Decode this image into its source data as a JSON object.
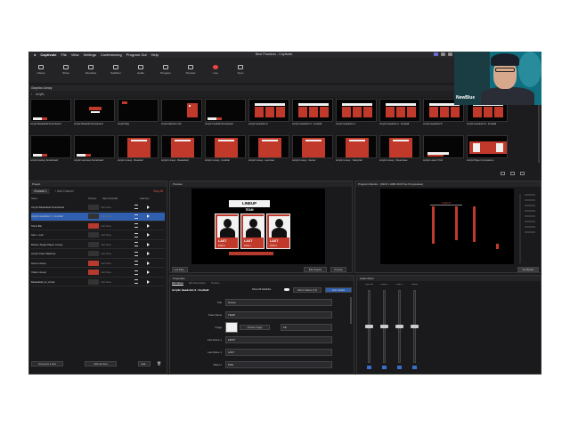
{
  "menubar": {
    "app": "Captivate",
    "items": [
      "File",
      "View",
      "Settings",
      "Conferencing",
      "Program Out",
      "Help"
    ],
    "window_title": "Best Practices - Captivate"
  },
  "toolbar": {
    "buttons": [
      "Library",
      "Show",
      "Favorites",
      "Switcher",
      "Audio",
      "Program",
      "Preview",
      "Live",
      "Sync"
    ]
  },
  "library": {
    "header": "Graphics Library",
    "path": "Acrylic",
    "row1": [
      "Acrylic Basketball Scoreboard",
      "Acrylic Baseball Scoreboard",
      "Acrylic Bug",
      "Acrylic Election Info",
      "Acrylic Football Scoreboard",
      "Acrylic Headshot 3",
      "Acrylic Headshot 3 - Football",
      "Acrylic Headshot 4",
      "Acrylic Headshot 4 - Football",
      "Acrylic Headshot 5",
      "Acrylic Headshot 5 - Football"
    ],
    "row2": [
      "Acrylic Hockey Scoreboard",
      "Acrylic Lacrosse Scoreboard",
      "Acrylic Lineup - Baseball",
      "Acrylic Lineup - Basketball",
      "Acrylic Lineup - Football",
      "Acrylic Lineup - Lacrosse",
      "Acrylic Lineup - Soccer",
      "Acrylic Lineup - Volleyball",
      "Acrylic Lineup - WLacrosse",
      "Acrylic Lower Third",
      "Acrylic Player Comparison"
    ]
  },
  "project": {
    "title": "Project",
    "channel": "Channel 1",
    "add_channel": "+ Add Channel",
    "stop_all": "Stop All",
    "columns": [
      "Name",
      "Preview",
      "Data Controller",
      "Hold Key"
    ],
    "rows": [
      {
        "name": "Acrylic Basketball Scoreboard",
        "ctrl": "Add Data..."
      },
      {
        "name": "Acrylic Headshot 3 - Football",
        "ctrl": "Add Data..."
      },
      {
        "name": "Show Bar",
        "ctrl": "Add Data..."
      },
      {
        "name": "Spin + Left",
        "ctrl": "Add Data..."
      },
      {
        "name": "Bottom Single Player Lineup",
        "ctrl": "Add Data..."
      },
      {
        "name": "Acrylic Team Matchup",
        "ctrl": "Add Data..."
      },
      {
        "name": "Home Lineup",
        "ctrl": "Add Data..."
      },
      {
        "name": "Visitor Lineup",
        "ctrl": "Add Data..."
      },
      {
        "name": "Basketball_for_Annie",
        "ctrl": "Add Data..."
      }
    ],
    "group_button": "Group into a shot",
    "add_button": "Add new item",
    "more_button": "Edit..."
  },
  "preview": {
    "title": "Preview",
    "lineup_title": "LINEUP",
    "team": "TEAM",
    "players": [
      {
        "last": "LAST",
        "pos": "POS",
        "num": "2"
      },
      {
        "last": "LAST",
        "pos": "POS",
        "num": "1"
      },
      {
        "last": "LAST",
        "pos": "POS",
        "num": "3"
      }
    ],
    "link_data": "Link Data...",
    "edit_graphic": "Edit Graphic",
    "preview_btn": "Preview"
  },
  "program": {
    "title": "Program Monitor - [1920 x 1080 29.97 fps Progressive]",
    "lineup_title": "LINEUP",
    "no_monitor": "No Monitor"
  },
  "properties": {
    "title": "Properties",
    "tabs": [
      "Edit Values",
      "Edit Data Dialog",
      "Timeline"
    ],
    "graphic_name": "Acrylic Headshot 3 - Football",
    "show_all": "Show All Variables",
    "add_to_values": "Add to Values (1.0)",
    "auto_update": "Auto Update",
    "fields": [
      {
        "label": "Title",
        "value": "Lineup"
      },
      {
        "label": "Team Name",
        "value": "TEAM"
      },
      {
        "label": "Image",
        "value": "Choose Image"
      },
      {
        "label": "First Name 1",
        "value": "FIRST"
      },
      {
        "label": "Last Name 1",
        "value": "LAST"
      },
      {
        "label": "Offset 1",
        "value": "POS"
      }
    ],
    "image_opt": "Fill"
  },
  "audio": {
    "title": "Audio Mixer",
    "channels": [
      "Input Mic",
      "Audio 2",
      "Audio 3",
      "Master"
    ],
    "level_fraction": 0.5
  },
  "webcam": {
    "name": "NewBlue"
  }
}
